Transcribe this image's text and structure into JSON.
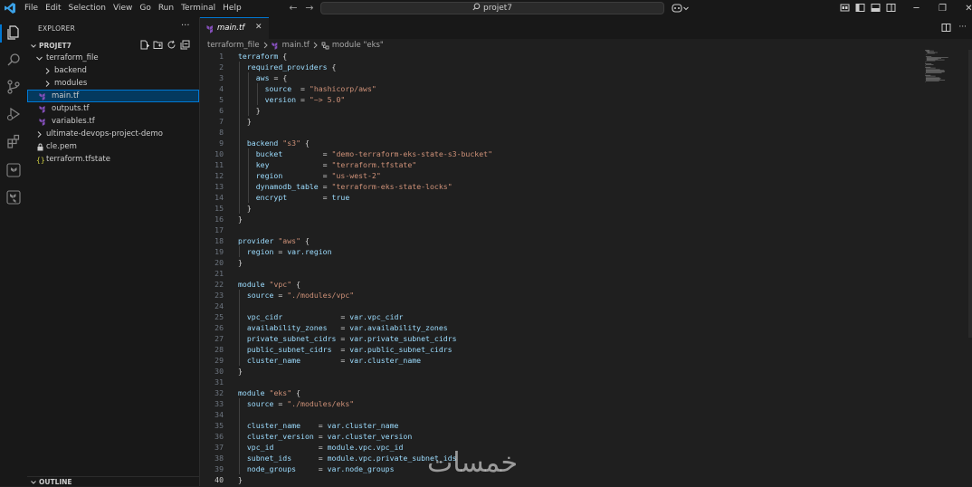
{
  "menu": [
    "File",
    "Edit",
    "Selection",
    "View",
    "Go",
    "Run",
    "Terminal",
    "Help"
  ],
  "search": {
    "text": "projet7"
  },
  "sidebar": {
    "header": "EXPLORER",
    "more": "···",
    "project": "PROJET7",
    "tree": [
      {
        "label": "terraform_file",
        "type": "folder-open"
      },
      {
        "label": "backend",
        "type": "folder"
      },
      {
        "label": "modules",
        "type": "folder"
      },
      {
        "label": "main.tf",
        "type": "tf-file",
        "selected": true
      },
      {
        "label": "outputs.tf",
        "type": "tf-file"
      },
      {
        "label": "variables.tf",
        "type": "tf-file"
      },
      {
        "label": "ultimate-devops-project-demo",
        "type": "folder"
      },
      {
        "label": "cle.pem",
        "type": "lock-file"
      },
      {
        "label": "terraform.tfstate",
        "type": "json-file"
      }
    ],
    "outline": "OUTLINE"
  },
  "editor": {
    "tab": {
      "label": "main.tf",
      "close": "✕"
    },
    "breadcrumb": [
      "terraform_file",
      "main.tf",
      "module \"eks\""
    ],
    "current_line": 40,
    "lines": [
      "terraform {",
      "  required_providers {",
      "    aws = {",
      "      source  = \"hashicorp/aws\"",
      "      version = \"~> 5.0\"",
      "    }",
      "  }",
      "",
      "  backend \"s3\" {",
      "    bucket         = \"demo-terraform-eks-state-s3-bucket\"",
      "    key            = \"terraform.tfstate\"",
      "    region         = \"us-west-2\"",
      "    dynamodb_table = \"terraform-eks-state-locks\"",
      "    encrypt        = true",
      "  }",
      "}",
      "",
      "provider \"aws\" {",
      "  region = var.region",
      "}",
      "",
      "module \"vpc\" {",
      "  source = \"./modules/vpc\"",
      "",
      "  vpc_cidr             = var.vpc_cidr",
      "  availability_zones   = var.availability_zones",
      "  private_subnet_cidrs = var.private_subnet_cidrs",
      "  public_subnet_cidrs  = var.public_subnet_cidrs",
      "  cluster_name         = var.cluster_name",
      "}",
      "",
      "module \"eks\" {",
      "  source = \"./modules/eks\"",
      "",
      "  cluster_name    = var.cluster_name",
      "  cluster_version = var.cluster_version",
      "  vpc_id          = module.vpc.vpc_id",
      "  subnet_ids      = module.vpc.private_subnet_ids",
      "  node_groups     = var.node_groups",
      "}"
    ]
  },
  "watermark": "خمسات",
  "colors": {
    "keyword": "#9cdcfe",
    "string": "#ce9178",
    "punct": "#d4d4d4",
    "accent": "#0078d4",
    "terraform": "#844fba"
  }
}
